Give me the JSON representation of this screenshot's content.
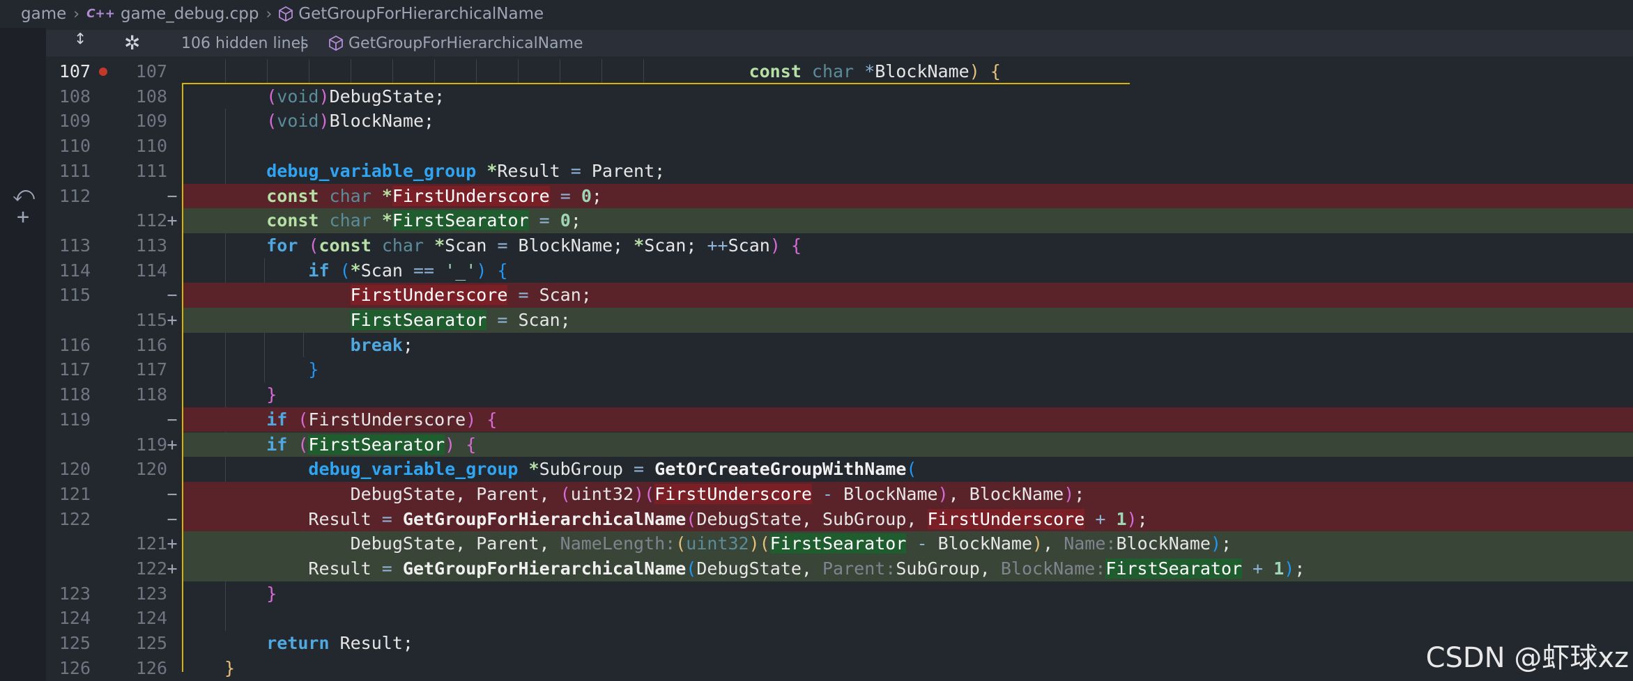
{
  "breadcrumb": {
    "project": "game",
    "file_badge": "C++",
    "file": "game_debug.cpp",
    "symbol": "GetGroupForHierarchicalName"
  },
  "fold": {
    "text": "106 hidden lines",
    "pipe": "|",
    "symbol": "GetGroupForHierarchicalName"
  },
  "activity": {
    "revert_glyph": "⤺",
    "add_glyph": "+"
  },
  "rows": [
    {
      "old": "107",
      "new": "107",
      "marker": "",
      "tokens": [
        [
          "",
          "                                                  "
        ],
        [
          "kw2b",
          "const"
        ],
        [
          "",
          " "
        ],
        [
          "tyn",
          "char"
        ],
        [
          "",
          " "
        ],
        [
          "op",
          "*"
        ],
        [
          "",
          "BlockName"
        ],
        [
          "pn3",
          ")"
        ],
        [
          "",
          " "
        ],
        [
          "pn3",
          "{"
        ]
      ]
    },
    {
      "old": "108",
      "new": "108",
      "marker": "",
      "tokens": [
        [
          "",
          "    "
        ],
        [
          "pn",
          "("
        ],
        [
          "tyn",
          "void"
        ],
        [
          "pn",
          ")"
        ],
        [
          "",
          "DebugState;"
        ]
      ]
    },
    {
      "old": "109",
      "new": "109",
      "marker": "",
      "tokens": [
        [
          "",
          "    "
        ],
        [
          "pn",
          "("
        ],
        [
          "tyn",
          "void"
        ],
        [
          "pn",
          ")"
        ],
        [
          "",
          "BlockName;"
        ]
      ]
    },
    {
      "old": "110",
      "new": "110",
      "marker": "",
      "tokens": []
    },
    {
      "old": "111",
      "new": "111",
      "marker": "",
      "tokens": [
        [
          "",
          "    "
        ],
        [
          "tp",
          "debug_variable_group"
        ],
        [
          "",
          " "
        ],
        [
          "ty",
          "*"
        ],
        [
          "",
          "Result "
        ],
        [
          "op",
          "="
        ],
        [
          "",
          " Parent;"
        ]
      ]
    },
    {
      "old": "112",
      "new": "",
      "marker": "−",
      "tokens": [
        [
          "",
          "    "
        ],
        [
          "ty",
          "const"
        ],
        [
          "",
          " "
        ],
        [
          "tyn",
          "char"
        ],
        [
          "",
          " "
        ],
        [
          "ty",
          "*"
        ],
        [
          "hl-del",
          "FirstUnderscore"
        ],
        [
          "",
          " "
        ],
        [
          "op",
          "="
        ],
        [
          "",
          " "
        ],
        [
          "num",
          "0"
        ],
        [
          "",
          ";"
        ]
      ]
    },
    {
      "old": "",
      "new": "112",
      "marker": "+",
      "tokens": [
        [
          "",
          "    "
        ],
        [
          "ty",
          "const"
        ],
        [
          "",
          " "
        ],
        [
          "tyn",
          "char"
        ],
        [
          "",
          " "
        ],
        [
          "ty",
          "*"
        ],
        [
          "hl-add",
          "FirstSearator"
        ],
        [
          "",
          " "
        ],
        [
          "op",
          "="
        ],
        [
          "",
          " "
        ],
        [
          "num",
          "0"
        ],
        [
          "",
          ";"
        ]
      ]
    },
    {
      "old": "113",
      "new": "113",
      "marker": "",
      "tokens": [
        [
          "",
          "    "
        ],
        [
          "kw",
          "for"
        ],
        [
          "",
          " "
        ],
        [
          "pn",
          "("
        ],
        [
          "ty",
          "const"
        ],
        [
          "",
          " "
        ],
        [
          "tyn",
          "char"
        ],
        [
          "",
          " "
        ],
        [
          "ty",
          "*"
        ],
        [
          "",
          "Scan "
        ],
        [
          "op",
          "="
        ],
        [
          "",
          " BlockName; "
        ],
        [
          "ty",
          "*"
        ],
        [
          "",
          "Scan; "
        ],
        [
          "op",
          "++"
        ],
        [
          "",
          "Scan"
        ],
        [
          "pn",
          ")"
        ],
        [
          "",
          " "
        ],
        [
          "pn",
          "{"
        ]
      ]
    },
    {
      "old": "114",
      "new": "114",
      "marker": "",
      "tokens": [
        [
          "",
          "        "
        ],
        [
          "kw",
          "if"
        ],
        [
          "",
          " "
        ],
        [
          "pn2",
          "("
        ],
        [
          "ty",
          "*"
        ],
        [
          "",
          "Scan "
        ],
        [
          "op",
          "=="
        ],
        [
          "",
          " "
        ],
        [
          "str",
          "'_'"
        ],
        [
          "pn2",
          ")"
        ],
        [
          "",
          " "
        ],
        [
          "pn2",
          "{"
        ]
      ]
    },
    {
      "old": "115",
      "new": "",
      "marker": "−",
      "tokens": [
        [
          "",
          "            "
        ],
        [
          "hl-del",
          "FirstUnderscore"
        ],
        [
          "",
          " "
        ],
        [
          "op",
          "="
        ],
        [
          "",
          " Scan;"
        ]
      ]
    },
    {
      "old": "",
      "new": "115",
      "marker": "+",
      "tokens": [
        [
          "",
          "            "
        ],
        [
          "hl-add",
          "FirstSearator"
        ],
        [
          "",
          " "
        ],
        [
          "op",
          "="
        ],
        [
          "",
          " Scan;"
        ]
      ]
    },
    {
      "old": "116",
      "new": "116",
      "marker": "",
      "tokens": [
        [
          "",
          "            "
        ],
        [
          "kw",
          "break"
        ],
        [
          "",
          ";"
        ]
      ]
    },
    {
      "old": "117",
      "new": "117",
      "marker": "",
      "tokens": [
        [
          "",
          "        "
        ],
        [
          "pn2",
          "}"
        ]
      ]
    },
    {
      "old": "118",
      "new": "118",
      "marker": "",
      "tokens": [
        [
          "",
          "    "
        ],
        [
          "pn",
          "}"
        ]
      ]
    },
    {
      "old": "119",
      "new": "",
      "marker": "−",
      "tokens": [
        [
          "",
          "    "
        ],
        [
          "kw",
          "if"
        ],
        [
          "",
          " "
        ],
        [
          "pn",
          "("
        ],
        [
          "",
          "FirstUnderscore"
        ],
        [
          "pn",
          ")"
        ],
        [
          "",
          " "
        ],
        [
          "pn",
          "{"
        ]
      ]
    },
    {
      "old": "",
      "new": "119",
      "marker": "+",
      "tokens": [
        [
          "",
          "    "
        ],
        [
          "kw",
          "if"
        ],
        [
          "",
          " "
        ],
        [
          "pn",
          "("
        ],
        [
          "hl-add",
          "FirstSearator"
        ],
        [
          "pn",
          ")"
        ],
        [
          "",
          " "
        ],
        [
          "pn",
          "{"
        ]
      ]
    },
    {
      "old": "120",
      "new": "120",
      "marker": "",
      "tokens": [
        [
          "",
          "        "
        ],
        [
          "tp",
          "debug_variable_group"
        ],
        [
          "",
          " "
        ],
        [
          "ty",
          "*"
        ],
        [
          "",
          "SubGroup "
        ],
        [
          "op",
          "="
        ],
        [
          "",
          " "
        ],
        [
          "fn",
          "GetOrCreateGroupWithName"
        ],
        [
          "pn2",
          "("
        ]
      ]
    },
    {
      "old": "121",
      "new": "",
      "marker": "−",
      "tokens": [
        [
          "",
          "            DebugState, Parent, "
        ],
        [
          "pn",
          "("
        ],
        [
          "",
          "uint32"
        ],
        [
          "pn",
          ")"
        ],
        [
          "pn",
          "("
        ],
        [
          "hl-del",
          "FirstUnderscore"
        ],
        [
          "",
          " "
        ],
        [
          "op",
          "-"
        ],
        [
          "",
          " BlockName"
        ],
        [
          "pn",
          ")"
        ],
        [
          "",
          ", BlockName"
        ],
        [
          "pn",
          ")"
        ],
        [
          "",
          ";"
        ]
      ]
    },
    {
      "old": "122",
      "new": "",
      "marker": "−",
      "tokens": [
        [
          "",
          "        Result "
        ],
        [
          "op",
          "="
        ],
        [
          "",
          " "
        ],
        [
          "fn",
          "GetGroupForHierarchicalName"
        ],
        [
          "pn",
          "("
        ],
        [
          "",
          "DebugState, SubGroup, "
        ],
        [
          "hl-del",
          "FirstUnderscore"
        ],
        [
          "",
          " "
        ],
        [
          "op",
          "+"
        ],
        [
          "",
          " "
        ],
        [
          "num",
          "1"
        ],
        [
          "pn",
          ")"
        ],
        [
          "",
          ";"
        ]
      ]
    },
    {
      "old": "",
      "new": "121",
      "marker": "+",
      "tokens": [
        [
          "",
          "            DebugState, Parent, "
        ],
        [
          "hint",
          "NameLength:"
        ],
        [
          "pn3",
          "("
        ],
        [
          "tyn",
          "uint32"
        ],
        [
          "pn3",
          ")"
        ],
        [
          "pn3",
          "("
        ],
        [
          "hl-add",
          "FirstSearator"
        ],
        [
          "",
          " "
        ],
        [
          "op",
          "-"
        ],
        [
          "",
          " BlockName"
        ],
        [
          "pn3",
          ")"
        ],
        [
          "",
          ", "
        ],
        [
          "hint",
          "Name:"
        ],
        [
          "",
          "BlockName"
        ],
        [
          "pn2",
          ")"
        ],
        [
          "",
          ";"
        ]
      ]
    },
    {
      "old": "",
      "new": "122",
      "marker": "+",
      "tokens": [
        [
          "",
          "        Result "
        ],
        [
          "op",
          "="
        ],
        [
          "",
          " "
        ],
        [
          "fn",
          "GetGroupForHierarchicalName"
        ],
        [
          "pn2",
          "("
        ],
        [
          "",
          "DebugState, "
        ],
        [
          "hint",
          "Parent:"
        ],
        [
          "",
          "SubGroup, "
        ],
        [
          "hint",
          "BlockName:"
        ],
        [
          "hl-add",
          "FirstSearator"
        ],
        [
          "",
          " "
        ],
        [
          "op",
          "+"
        ],
        [
          "",
          " "
        ],
        [
          "num",
          "1"
        ],
        [
          "pn2",
          ")"
        ],
        [
          "",
          ";"
        ]
      ]
    },
    {
      "old": "123",
      "new": "123",
      "marker": "",
      "tokens": [
        [
          "",
          "    "
        ],
        [
          "pn",
          "}"
        ]
      ]
    },
    {
      "old": "124",
      "new": "124",
      "marker": "",
      "tokens": []
    },
    {
      "old": "125",
      "new": "125",
      "marker": "",
      "tokens": [
        [
          "",
          "    "
        ],
        [
          "kw",
          "return"
        ],
        [
          "",
          " Result;"
        ]
      ]
    },
    {
      "old": "126",
      "new": "126",
      "marker": "",
      "tokens": [
        [
          "pn3",
          "}"
        ]
      ]
    }
  ],
  "watermark": "CSDN @虾球xz"
}
